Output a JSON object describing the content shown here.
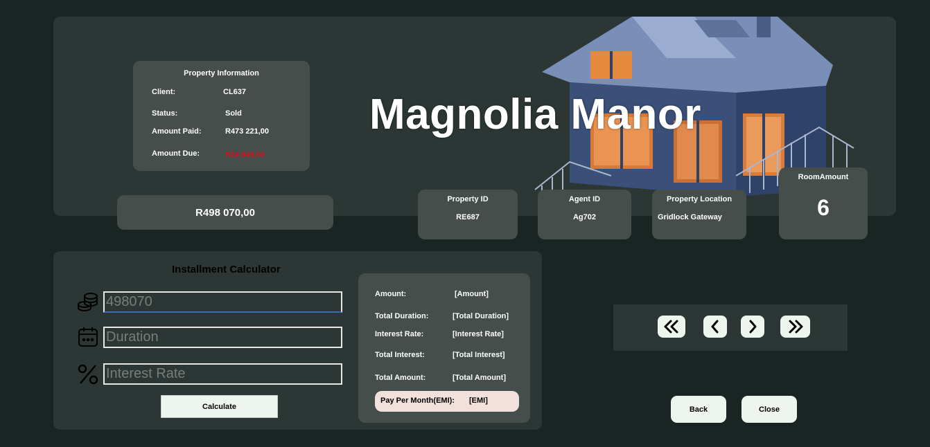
{
  "property": {
    "name": "Magnolia Manor",
    "price": "R498 070,00",
    "info": {
      "title": "Property Information",
      "client_label": "Client:",
      "client_value": "CL637",
      "status_label": "Status:",
      "status_value": "Sold",
      "paid_label": "Amount Paid:",
      "paid_value": "R473 221,00",
      "due_label": "Amount Due:",
      "due_value": "R24 849,00"
    },
    "cards": {
      "property_id_label": "Property ID",
      "property_id_value": "RE687",
      "agent_id_label": "Agent ID",
      "agent_id_value": "Ag702",
      "location_label": "Property Location",
      "location_value": "Gridlock Gateway",
      "room_label": "RoomAmount",
      "room_value": "6"
    }
  },
  "calculator": {
    "title": "Installment Calculator",
    "amount_input_value": "498070",
    "duration_placeholder": "Duration",
    "interest_placeholder": "Interest Rate",
    "calculate_label": "Calculate",
    "results": {
      "amount_label": "Amount:",
      "amount_value": "[Amount]",
      "duration_label": "Total Duration:",
      "duration_value": "[Total Duration]",
      "rate_label": "Interest Rate:",
      "rate_value": "[Interest Rate]",
      "interest_label": "Total Interest:",
      "interest_value": "[Total Interest]",
      "total_label": "Total Amount:",
      "total_value": "[Total Amount]",
      "emi_label": "Pay Per Month(EMI):",
      "emi_value": "[EMI]"
    }
  },
  "actions": {
    "back_label": "Back",
    "close_label": "Close"
  },
  "icons": [
    "coins-icon",
    "calendar-icon",
    "percent-icon",
    "first-page-icon",
    "previous-icon",
    "next-icon",
    "last-page-icon"
  ],
  "colors": {
    "background": "#1a2423",
    "panel": "#2c3735",
    "card": "#464e4c",
    "amount_due": "#d01018",
    "button": "#eef5ef",
    "emi_bg": "#f2e0dd"
  }
}
